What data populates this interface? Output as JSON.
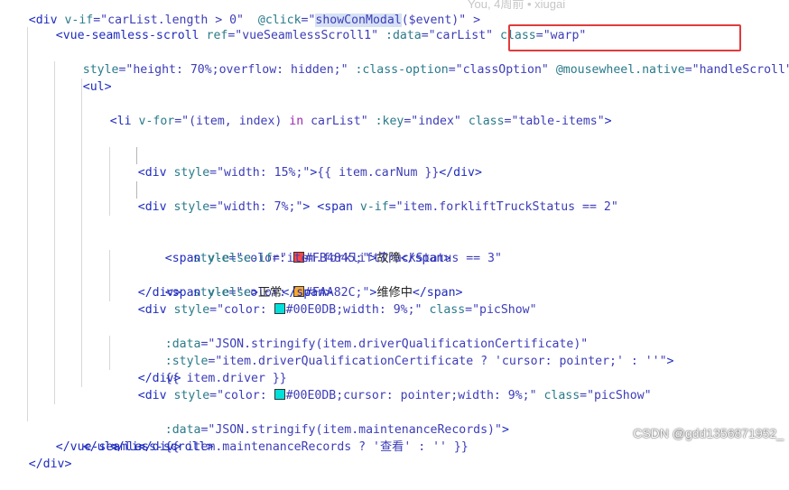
{
  "editor": {
    "blame": "You, 4周前 • xiugai",
    "lines": {
      "l0": {
        "pre": "<div ",
        "kw1": "v-if",
        "eq": "=\"",
        "a": "carList.length > 0",
        "q": "\" ",
        "ev": "@click",
        "eq2": "=\"",
        "fn": "showConModal",
        "rest": "($event)\" >"
      },
      "l1": {
        "open": "<vue-seamless-scroll",
        "ref": " ref",
        "refv": "=\"vueSeamlessScroll1\"",
        "data": " :data",
        "datav": "=\"carList\"",
        "cls": " class",
        "clsv": "=\"warp\""
      },
      "l2": {
        "style": "style",
        "stylev": "=\"height: 70%;overflow: hidden;\"",
        "co": " :class-option",
        "cov": "=\"classOption\"",
        "mw": "@mousewheel.native",
        "mwv": "=\"handleScroll\"",
        "end": ">"
      },
      "l3": "<ul>",
      "l4": {
        "open": "<li ",
        "vfor": "v-for",
        "vforv": "=\"(item, index) ",
        "in": "in",
        "vforv2": " carList\"",
        "key": " :key",
        "keyv": "=\"index\"",
        "cls": " class",
        "clsv": "=\"table-items\"",
        "end": ">"
      },
      "l6": {
        "open": "<div ",
        "style": "style",
        "stylev": "=\"width: 15%;\"",
        "gt": ">",
        "bind": "{{ item.carNum }}",
        "close": "</div>"
      },
      "l8": {
        "open": "<div ",
        "style": "style",
        "stylev": "=\"width: 7%;\"",
        "gt": "> ",
        "span": "<span ",
        "vif": "v-if",
        "vifv": "=\"item.forkliftTruckStatus == 2\""
      },
      "l9": {
        "style": "style",
        "stylev1": "=\"color: ",
        "color": "#FB4845",
        "stylev2": ";\"",
        "gt": ">",
        "text": "故障",
        "close": "</span>"
      },
      "l10": {
        "span": "<span ",
        "velseif": "v-else-if",
        "v": "=\"item.forkliftTruckStatus == 3\""
      },
      "l11": {
        "style": "style",
        "stylev1": "=\"color: ",
        "color": "#FAA82C",
        "stylev2": ";\"",
        "gt": ">",
        "text": "维修中",
        "close": "</span>"
      },
      "l12": {
        "span": "<span ",
        "velse": "v-else",
        "gt": ">",
        "text": "正常",
        "close": "</span>"
      },
      "l13": "</div>",
      "l14": {
        "open": "<div ",
        "style": "style",
        "stylev1": "=\"color: ",
        "color": "#00E0DB",
        "stylev2": ";width: 9%;\"",
        "cls": " class",
        "clsv": "=\"picShow\""
      },
      "l15": {
        "attr": ":data",
        "v": "=\"JSON.stringify(item.driverQualificationCertificate)\""
      },
      "l16": {
        "attr": ":style",
        "v": "=\"item.driverQualificationCertificate ? 'cursor: pointer;' : ''\"",
        "end": ">"
      },
      "l17": "{{ item.driver }}",
      "l18": "</div>",
      "l19": {
        "open": "<div ",
        "style": "style",
        "stylev1": "=\"color: ",
        "color": "#00E0DB",
        "stylev2": ";cursor: pointer;width: 9%;\"",
        "cls": " class",
        "clsv": "=\"picShow\""
      },
      "l20": {
        "attr": ":data",
        "v": "=\"JSON.stringify(item.maintenanceRecords)\"",
        "end": ">"
      },
      "l21": "{{ item.maintenanceRecords ? '查看' : '' }}",
      "l22": "</div>",
      "l23": "</li>",
      "l24": "</ul>",
      "l25": "</vue-seamless-scroll>",
      "l26": "</div>"
    },
    "colors": {
      "fault": "#FB4845",
      "repair": "#FAA82C",
      "cyan": "#00E0DB",
      "highlight": "#e03b3b"
    }
  },
  "watermark": "CSDN @gdd1356871952_"
}
